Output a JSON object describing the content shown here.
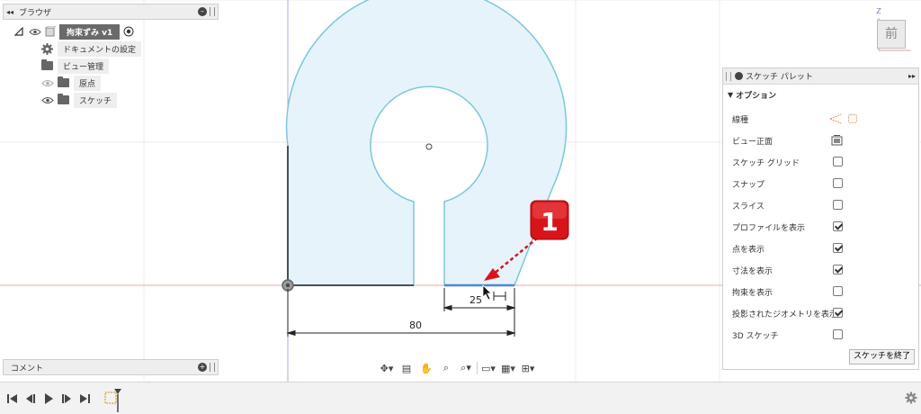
{
  "browser": {
    "title": "ブラウザ",
    "root_label": "拘束ずみ v1",
    "items": [
      {
        "label": "ドキュメントの設定",
        "icon": "gear-icon"
      },
      {
        "label": "ビュー管理",
        "icon": "folder-icon"
      },
      {
        "label": "原点",
        "icon": "folder-icon"
      },
      {
        "label": "スケッチ",
        "icon": "folder-icon"
      }
    ]
  },
  "comments": {
    "title": "コメント"
  },
  "palette": {
    "title": "スケッチ パレット",
    "section": "オプション",
    "rows": [
      {
        "label": "線種",
        "kind": "icons"
      },
      {
        "label": "ビュー正面",
        "kind": "button"
      },
      {
        "label": "スケッチ グリッド",
        "kind": "checkbox",
        "checked": false
      },
      {
        "label": "スナップ",
        "kind": "checkbox",
        "checked": false
      },
      {
        "label": "スライス",
        "kind": "checkbox",
        "checked": false
      },
      {
        "label": "プロファイルを表示",
        "kind": "checkbox",
        "checked": true
      },
      {
        "label": "点を表示",
        "kind": "checkbox",
        "checked": true
      },
      {
        "label": "寸法を表示",
        "kind": "checkbox",
        "checked": true
      },
      {
        "label": "拘束を表示",
        "kind": "checkbox",
        "checked": false
      },
      {
        "label": "投影されたジオメトリを表示",
        "kind": "checkbox",
        "checked": true
      },
      {
        "label": "3D スケッチ",
        "kind": "checkbox",
        "checked": false
      }
    ],
    "finish_label": "スケッチを終了"
  },
  "viewcube": {
    "face_label": "前",
    "axis_label": "Z"
  },
  "sketch": {
    "dim_small": "25",
    "dim_large": "80",
    "callout": "1"
  },
  "colors": {
    "profile_fill": "#e6f3fb",
    "profile_stroke": "#7cc7de",
    "callout": "#d8141b",
    "selected_line": "#4a86d8",
    "grid": "#e8e8e8"
  }
}
